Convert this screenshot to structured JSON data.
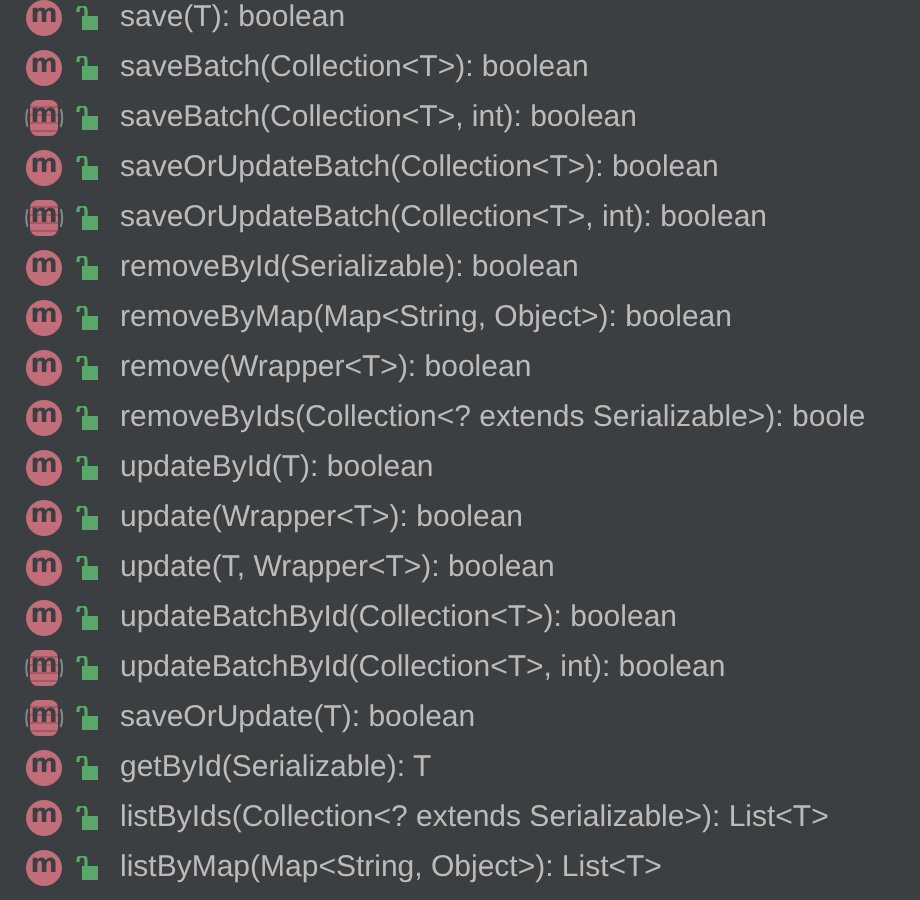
{
  "members": [
    {
      "kind": "method",
      "badge": "m",
      "signature": "save(T): boolean"
    },
    {
      "kind": "method",
      "badge": "m",
      "signature": "saveBatch(Collection<T>): boolean"
    },
    {
      "kind": "default_method",
      "badge": "m",
      "signature": "saveBatch(Collection<T>, int): boolean"
    },
    {
      "kind": "method",
      "badge": "m",
      "signature": "saveOrUpdateBatch(Collection<T>): boolean"
    },
    {
      "kind": "default_method",
      "badge": "m",
      "signature": "saveOrUpdateBatch(Collection<T>, int): boolean"
    },
    {
      "kind": "method",
      "badge": "m",
      "signature": "removeById(Serializable): boolean"
    },
    {
      "kind": "method",
      "badge": "m",
      "signature": "removeByMap(Map<String, Object>): boolean"
    },
    {
      "kind": "method",
      "badge": "m",
      "signature": "remove(Wrapper<T>): boolean"
    },
    {
      "kind": "method",
      "badge": "m",
      "signature": "removeByIds(Collection<? extends Serializable>): boole"
    },
    {
      "kind": "method",
      "badge": "m",
      "signature": "updateById(T): boolean"
    },
    {
      "kind": "method",
      "badge": "m",
      "signature": "update(Wrapper<T>): boolean"
    },
    {
      "kind": "method",
      "badge": "m",
      "signature": "update(T, Wrapper<T>): boolean"
    },
    {
      "kind": "method",
      "badge": "m",
      "signature": "updateBatchById(Collection<T>): boolean"
    },
    {
      "kind": "default_method",
      "badge": "m",
      "signature": "updateBatchById(Collection<T>, int): boolean"
    },
    {
      "kind": "default_method",
      "badge": "m",
      "signature": "saveOrUpdate(T): boolean"
    },
    {
      "kind": "method",
      "badge": "m",
      "signature": "getById(Serializable): T"
    },
    {
      "kind": "method",
      "badge": "m",
      "signature": "listByIds(Collection<? extends Serializable>): List<T>"
    },
    {
      "kind": "method",
      "badge": "m",
      "signature": "listByMap(Map<String, Object>): List<T>"
    }
  ]
}
